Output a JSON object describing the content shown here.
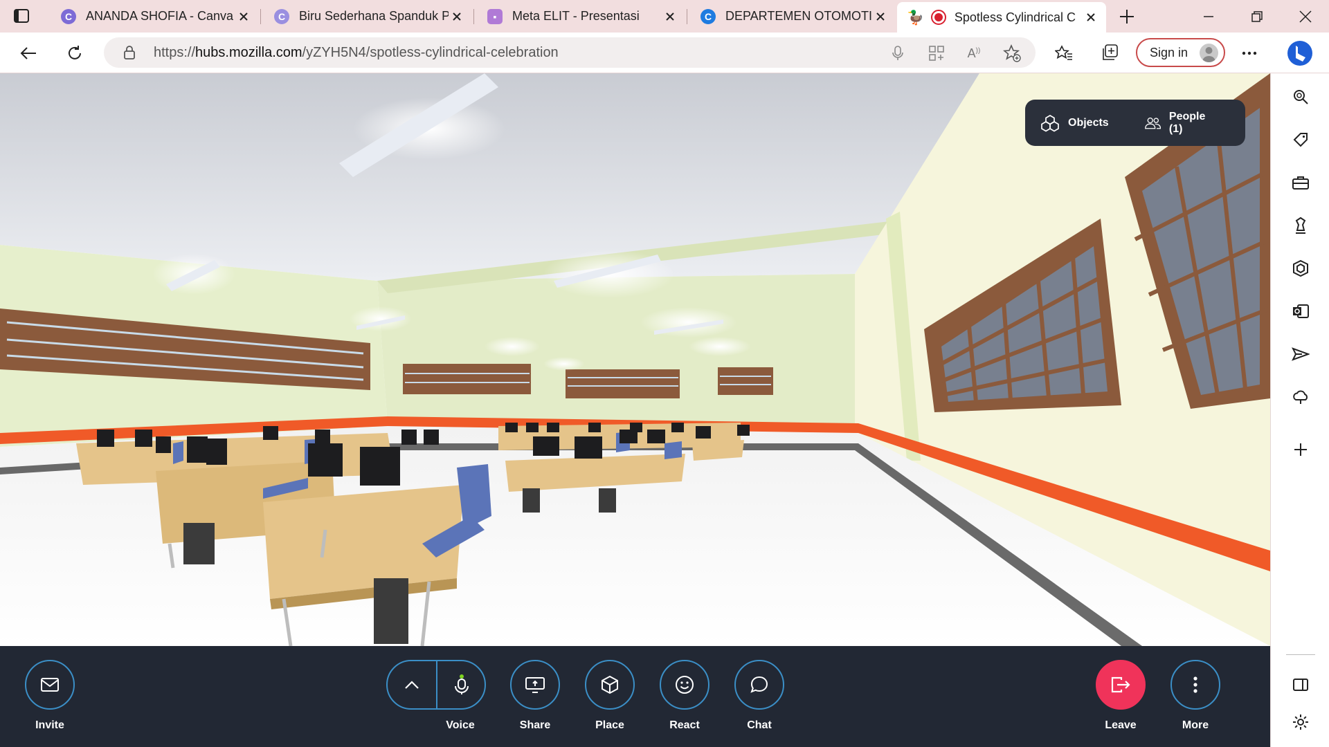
{
  "browser": {
    "tabs": [
      {
        "title": "ANANDA SHOFIA - Canva",
        "icon": "canva-icon",
        "active": false
      },
      {
        "title": "Biru Sederhana Spanduk P",
        "icon": "canva-icon",
        "active": false
      },
      {
        "title": "Meta ELIT - Presentasi",
        "icon": "presentation-icon",
        "active": false
      },
      {
        "title": "DEPARTEMEN OTOMOTIF",
        "icon": "canva-icon",
        "active": false
      },
      {
        "title": "Spotless Cylindrical C",
        "icon": "recording-icon",
        "active": true
      }
    ],
    "address": {
      "prefix": "https://",
      "host": "hubs.mozilla.com",
      "path": "/yZYH5N4/spotless-cylindrical-celebration"
    },
    "sign_in_label": "Sign in"
  },
  "hud": {
    "objects_label": "Objects",
    "people_label": "People (1)"
  },
  "toolbar": {
    "invite_label": "Invite",
    "voice_label": "Voice",
    "share_label": "Share",
    "place_label": "Place",
    "react_label": "React",
    "chat_label": "Chat",
    "leave_label": "Leave",
    "more_label": "More"
  },
  "colors": {
    "tab_strip": "#f2dedf",
    "hud_panel": "#2b303b",
    "bottom_bar": "#222834",
    "button_ring": "#3b8fc7",
    "leave_button": "#f0335a",
    "mic_active_dot": "#7ed321",
    "wall": "#e8f0cc",
    "stripe": "#f05a28",
    "desk": "#e5c48a",
    "chair": "#5b74b8"
  },
  "sidebar_icons": [
    "search-icon",
    "tag-icon",
    "briefcase-icon",
    "chess-icon",
    "office-icon",
    "outlook-icon",
    "send-icon",
    "cloud-icon",
    "add-icon",
    "sidepanel-icon",
    "settings-icon"
  ]
}
